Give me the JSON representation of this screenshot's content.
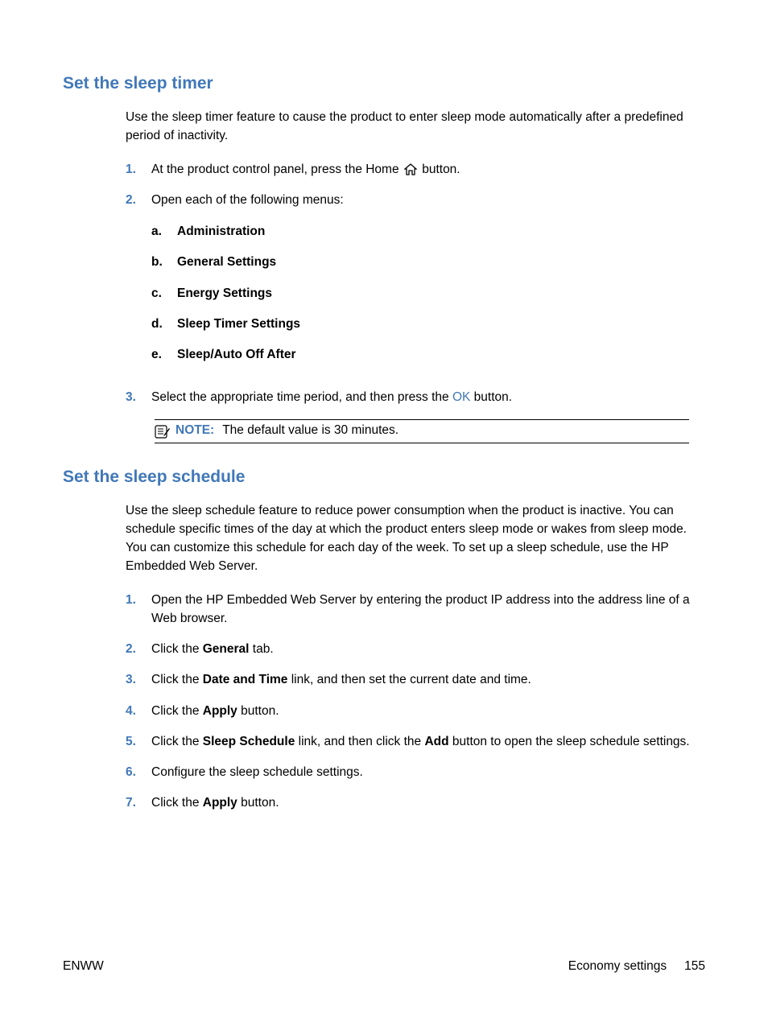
{
  "section1": {
    "heading": "Set the sleep timer",
    "intro": "Use the sleep timer feature to cause the product to enter sleep mode automatically after a predefined period of inactivity.",
    "step1_pre": "At the product control panel, press the Home ",
    "step1_post": " button.",
    "step2": "Open each of the following menus:",
    "submenus": {
      "a": "Administration",
      "b": "General Settings",
      "c": "Energy Settings",
      "d": "Sleep Timer Settings",
      "e": "Sleep/Auto Off After"
    },
    "step3_pre": "Select the appropriate time period, and then press the ",
    "step3_ok": "OK",
    "step3_post": " button.",
    "note_label": "NOTE:",
    "note_text": "The default value is 30 minutes."
  },
  "section2": {
    "heading": "Set the sleep schedule",
    "intro": "Use the sleep schedule feature to reduce power consumption when the product is inactive. You can schedule specific times of the day at which the product enters sleep mode or wakes from sleep mode. You can customize this schedule for each day of the week. To set up a sleep schedule, use the HP Embedded Web Server.",
    "step1": "Open the HP Embedded Web Server by entering the product IP address into the address line of a Web browser.",
    "step2_pre": "Click the ",
    "step2_bold": "General",
    "step2_post": " tab.",
    "step3_pre": "Click the ",
    "step3_bold": "Date and Time",
    "step3_post": " link, and then set the current date and time.",
    "step4_pre": "Click the ",
    "step4_bold": "Apply",
    "step4_post": " button.",
    "step5_pre": "Click the ",
    "step5_bold1": "Sleep Schedule",
    "step5_mid": " link, and then click the ",
    "step5_bold2": "Add",
    "step5_post": " button to open the sleep schedule settings.",
    "step6": "Configure the sleep schedule settings.",
    "step7_pre": "Click the ",
    "step7_bold": "Apply",
    "step7_post": " button."
  },
  "markers": {
    "n1": "1.",
    "n2": "2.",
    "n3": "3.",
    "n4": "4.",
    "n5": "5.",
    "n6": "6.",
    "n7": "7.",
    "a": "a.",
    "b": "b.",
    "c": "c.",
    "d": "d.",
    "e": "e."
  },
  "footer": {
    "left": "ENWW",
    "right_text": "Economy settings",
    "page": "155"
  }
}
